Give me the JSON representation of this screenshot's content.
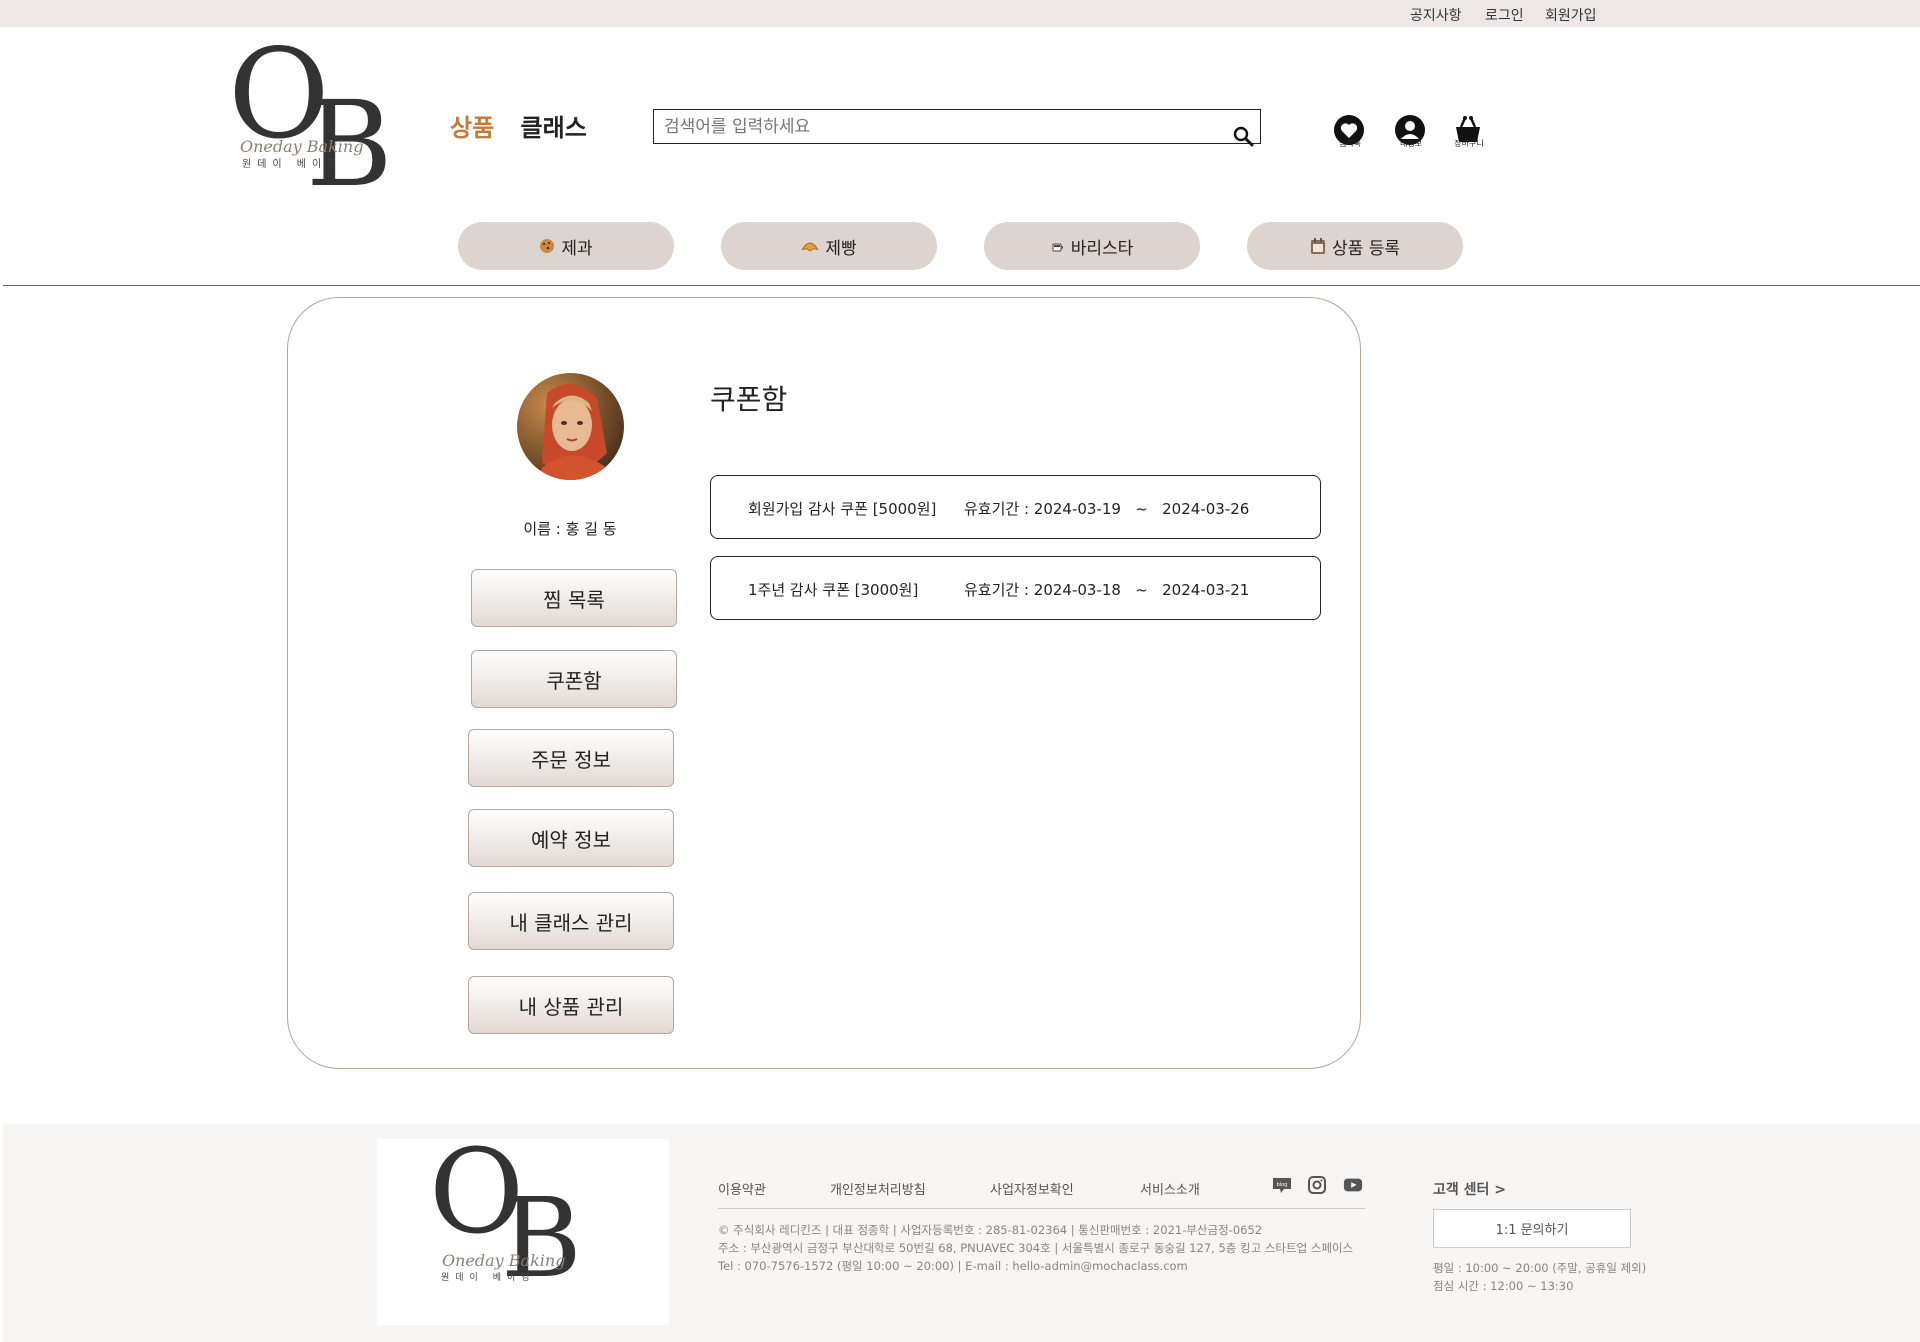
{
  "topbar": {
    "notice": "공지사항",
    "login": "로그인",
    "signup": "회원가입"
  },
  "logo": {
    "letters_o": "O",
    "letters_b": "B",
    "script": "Oneday Baking",
    "korean": "원데이 베이킹"
  },
  "nav": {
    "tab_products": "상품",
    "tab_classes": "클래스"
  },
  "search": {
    "placeholder": "검색어를 입력하세요"
  },
  "utility": {
    "wishlist": "찜목록",
    "mypage": "내정보",
    "cart": "장바구니"
  },
  "categories": [
    {
      "icon": "cookie-icon",
      "label": "제과"
    },
    {
      "icon": "croissant-icon",
      "label": "제빵"
    },
    {
      "icon": "coffee-icon",
      "label": "바리스타"
    },
    {
      "icon": "calendar-icon",
      "label": "상품 등록"
    }
  ],
  "profile": {
    "name_label": "이름 : 홍 길 동"
  },
  "sidebar": [
    {
      "label": "찜 목록"
    },
    {
      "label": "쿠폰함"
    },
    {
      "label": "주문 정보"
    },
    {
      "label": "예약 정보"
    },
    {
      "label": "내 클래스 관리"
    },
    {
      "label": "내 상품 관리"
    }
  ],
  "main": {
    "title": "쿠폰함"
  },
  "coupons": [
    {
      "name": "회원가입 감사 쿠폰 [5000원]",
      "period": "유효기간 : 2024-03-19   ~   2024-03-26"
    },
    {
      "name": "1주년 감사 쿠폰 [3000원]",
      "period": "유효기간 : 2024-03-18   ~   2024-03-21"
    }
  ],
  "footer": {
    "links": [
      "이용약관",
      "개인정보처리방침",
      "사업자정보확인",
      "서비스소개"
    ],
    "info": [
      "© 주식회사 레디킨즈 | 대표 정종학 | 사업자등록번호 : 285-81-02364 | 통신판매번호 : 2021-부산금정-0652",
      "주소 : 부산광역시 금정구 부산대학로 50번길 68, PNUAVEC 304호 | 서울특별시 종로구 동숭길 127, 5층 킹고 스타트업 스페이스",
      "Tel : 070-7576-1572 (평일 10:00 ~ 20:00) | E-mail : hello-admin@mochaclass.com"
    ],
    "social": [
      "blog-icon",
      "instagram-icon",
      "youtube-icon"
    ],
    "cs_title": "고객 센터 >",
    "cs_button": "1:1 문의하기",
    "cs_hours": [
      "평일 : 10:00 ~ 20:00 (주말, 공휴일 제외)",
      "점심 시간 : 12:00 ~ 13:30"
    ]
  },
  "colors": {
    "accent": "#c47a3a",
    "pill": "#ddd4cf",
    "topbar": "#ede8e5",
    "panel_border": "#b8a596"
  }
}
